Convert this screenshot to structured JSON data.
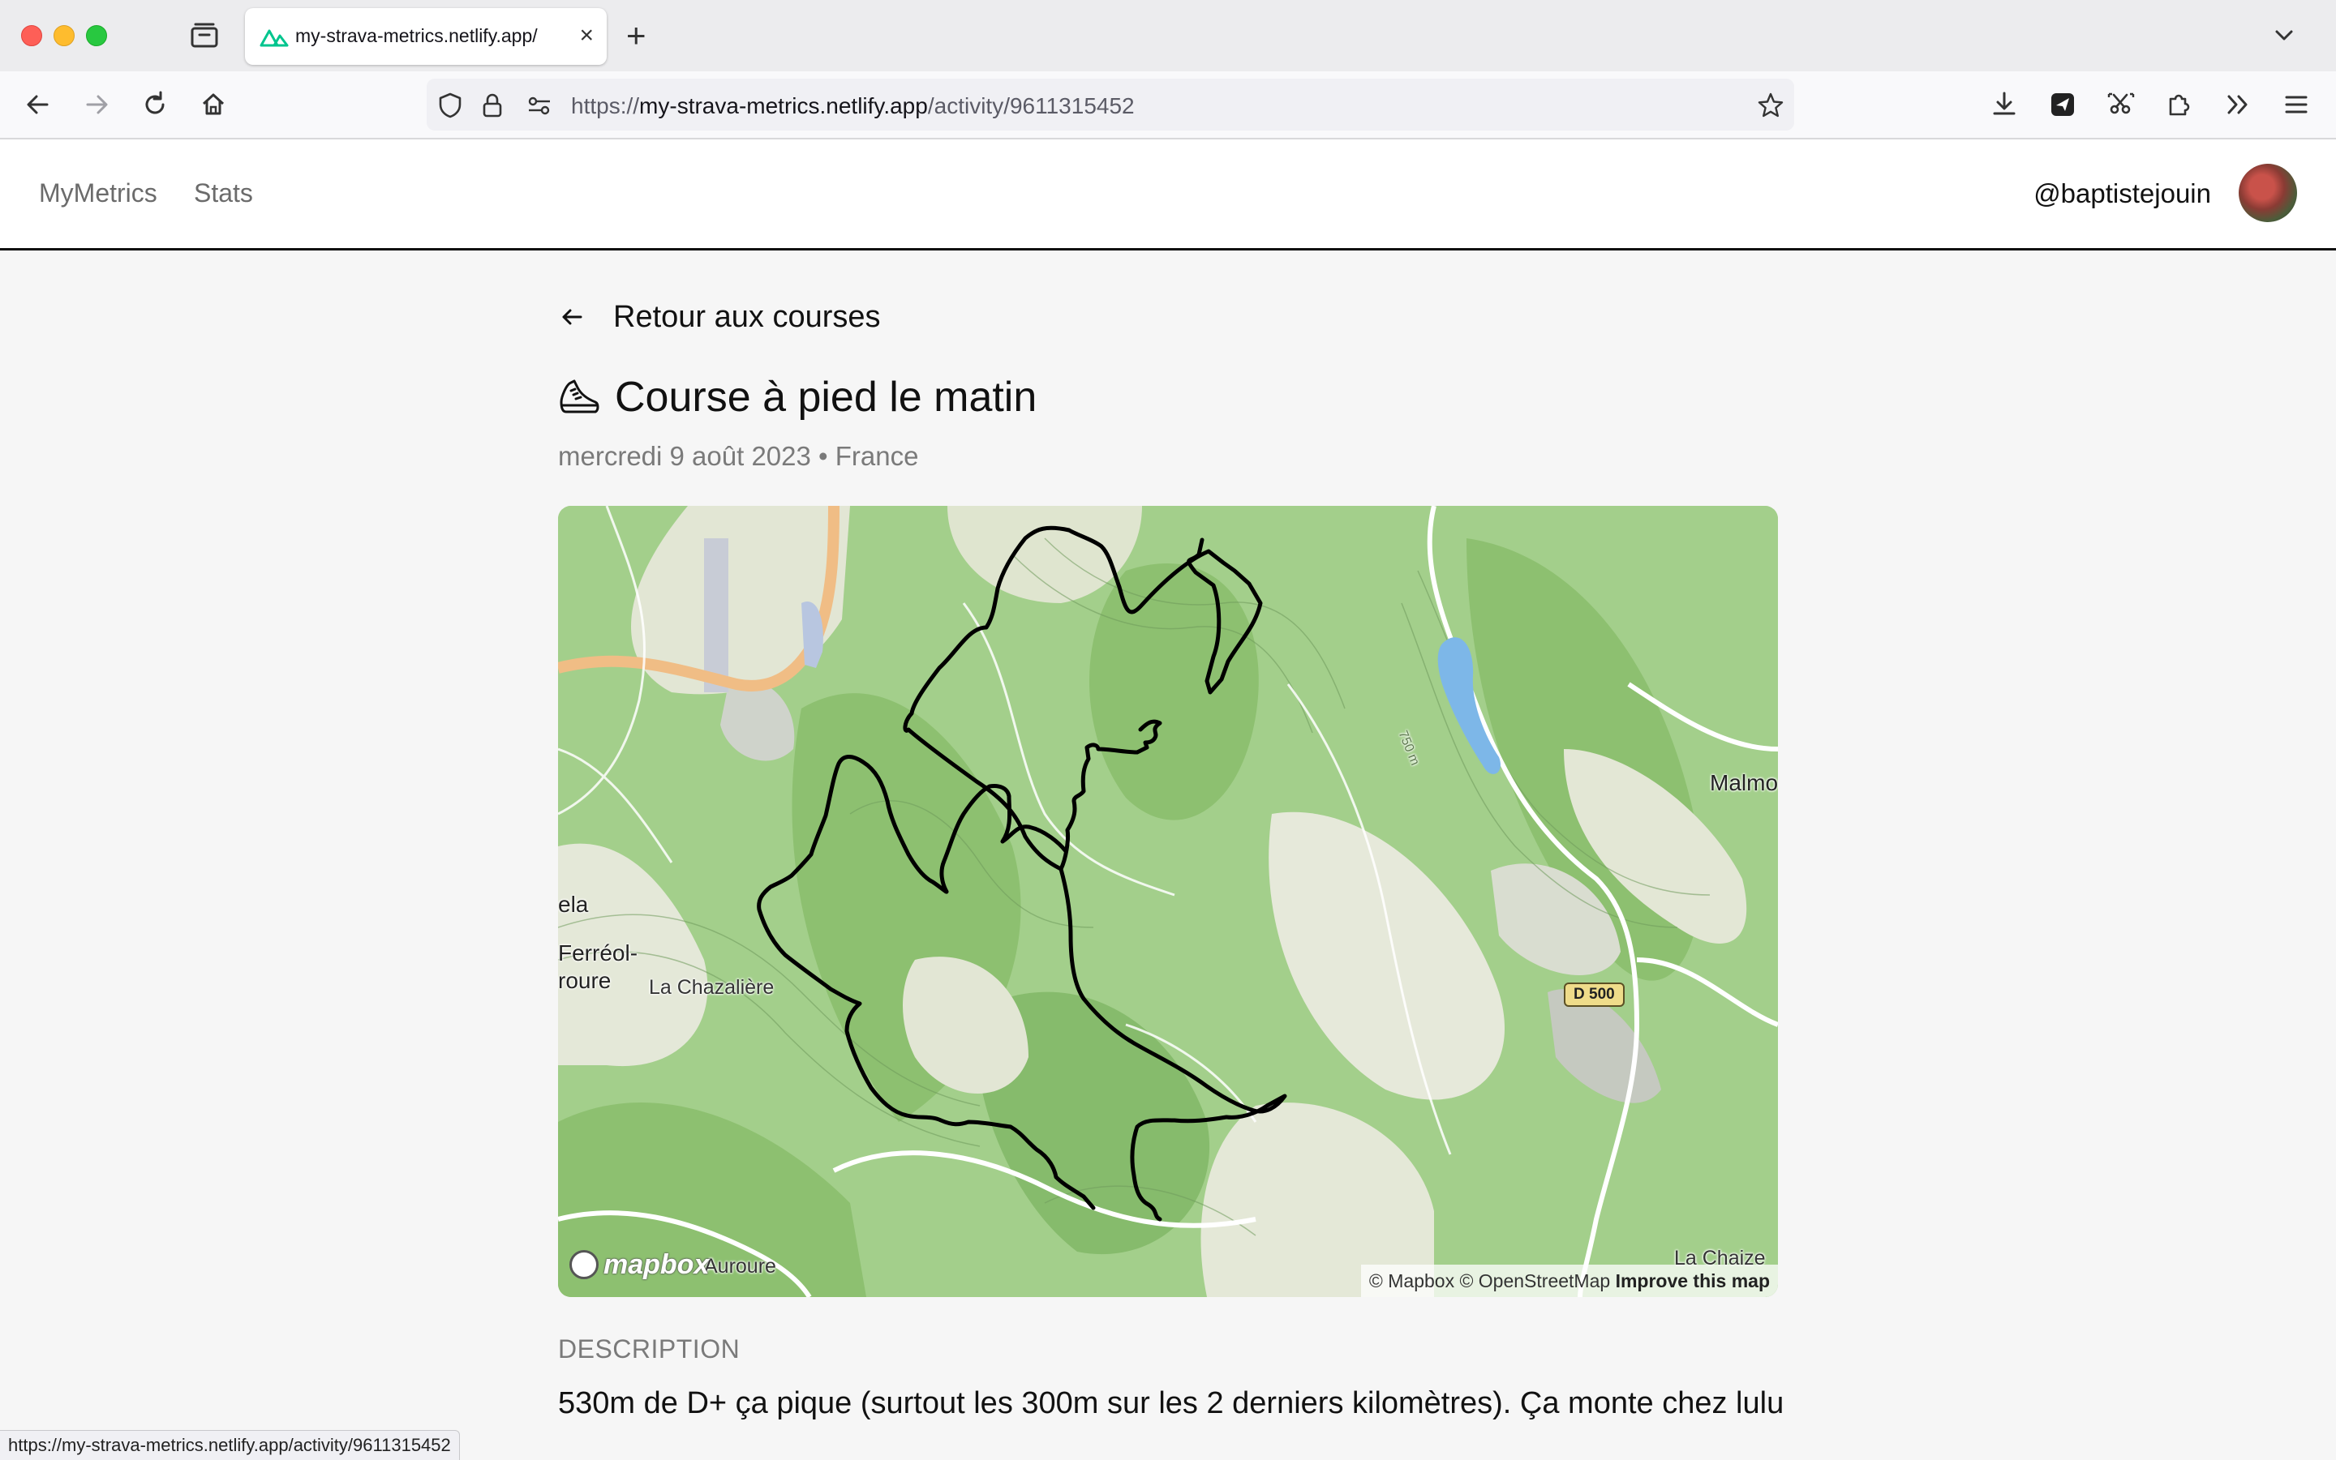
{
  "browser": {
    "tab_title": "my-strava-metrics.netlify.app/",
    "url_scheme": "https://",
    "url_host": "my-strava-metrics.netlify.app",
    "url_path": "/activity/9611315452",
    "status_url": "https://my-strava-metrics.netlify.app/activity/9611315452"
  },
  "header": {
    "brand": "MyMetrics",
    "nav_stats": "Stats",
    "username": "@baptistejouin"
  },
  "activity": {
    "back_label": "Retour aux courses",
    "title": "Course à pied le matin",
    "subtitle": "mercredi 9 août 2023 • France",
    "description_heading": "DESCRIPTION",
    "description": "530m de D+ ça pique (surtout les 300m sur les 2 derniers kilomètres). Ça monte chez lulu"
  },
  "map": {
    "labels": {
      "malmo": "Malmo",
      "ela": "ela",
      "ferreol": "Ferréol-",
      "roure": "roure",
      "chazaliere": "La Chazalière",
      "auroure": "Auroure",
      "chaize": "La Chaize",
      "contour": "750 m",
      "road": "D 500"
    },
    "logo_text": "mapbox",
    "attribution": "© Mapbox © OpenStreetMap",
    "improve": "Improve this map",
    "colors": {
      "forest": "#9ccb82",
      "dark_forest": "#86bb6c",
      "open": "#e4e8d8",
      "route": "#000000",
      "water": "#7db7e8",
      "major_road": "#f2c189"
    }
  }
}
